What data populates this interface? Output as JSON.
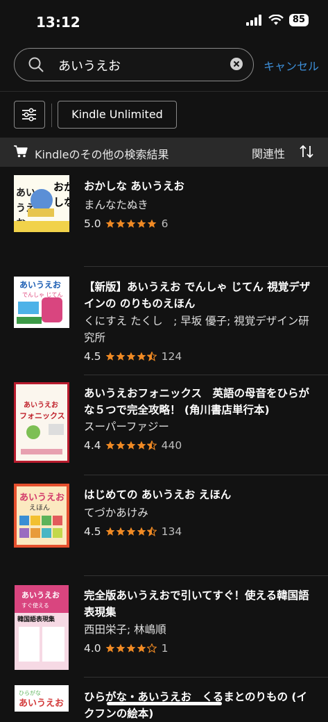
{
  "status": {
    "time": "13:12",
    "battery": "85"
  },
  "search": {
    "query": "あいうえお",
    "cancel_label": "キャンセル"
  },
  "filters": {
    "kindle_unlimited_label": "Kindle Unlimited"
  },
  "results_header": {
    "label": "Kindleのその他の検索結果",
    "sort_label": "関連性"
  },
  "colors": {
    "accent_link": "#3d8fd9",
    "star": "#f08a24",
    "background": "#121212"
  },
  "items": [
    {
      "title": "おかしな あいうえお",
      "author": "まんなたぬき",
      "rating": "5.0",
      "stars": 5,
      "count": "6",
      "cover_text": "おかしなあいうえお"
    },
    {
      "title": "【新版】あいうえお でんしゃ じてん 視覚デザインの のりものえほん",
      "author": "くにすえ たくし　; 早坂 優子; 視覚デザイン研究所",
      "rating": "4.5",
      "stars": 4.5,
      "count": "124",
      "cover_text": "あいうえお でんしゃ じてん"
    },
    {
      "title": "あいうえおフォニックス　英語の母音をひらがな５つで完全攻略！ (角川書店単行本)",
      "author": "スーパーファジー",
      "rating": "4.4",
      "stars": 4.5,
      "count": "440",
      "cover_text": "あいうえお フォニックス"
    },
    {
      "title": "はじめての あいうえお えほん",
      "author": "てづかあけみ",
      "rating": "4.5",
      "stars": 4.5,
      "count": "134",
      "cover_text": "あいうえお えほん"
    },
    {
      "title": "完全版あいうえおで引いてすぐ！使える韓国語表現集",
      "author": "西田栄子; 林嶋順",
      "rating": "4.0",
      "stars": 4,
      "count": "1",
      "cover_text": "韓国語表現集"
    },
    {
      "title": "ひらがな・あいうえお　くるまとのりもの (イクフンの絵本)",
      "cover_text": "あいうえお くるまとのりもの"
    }
  ]
}
